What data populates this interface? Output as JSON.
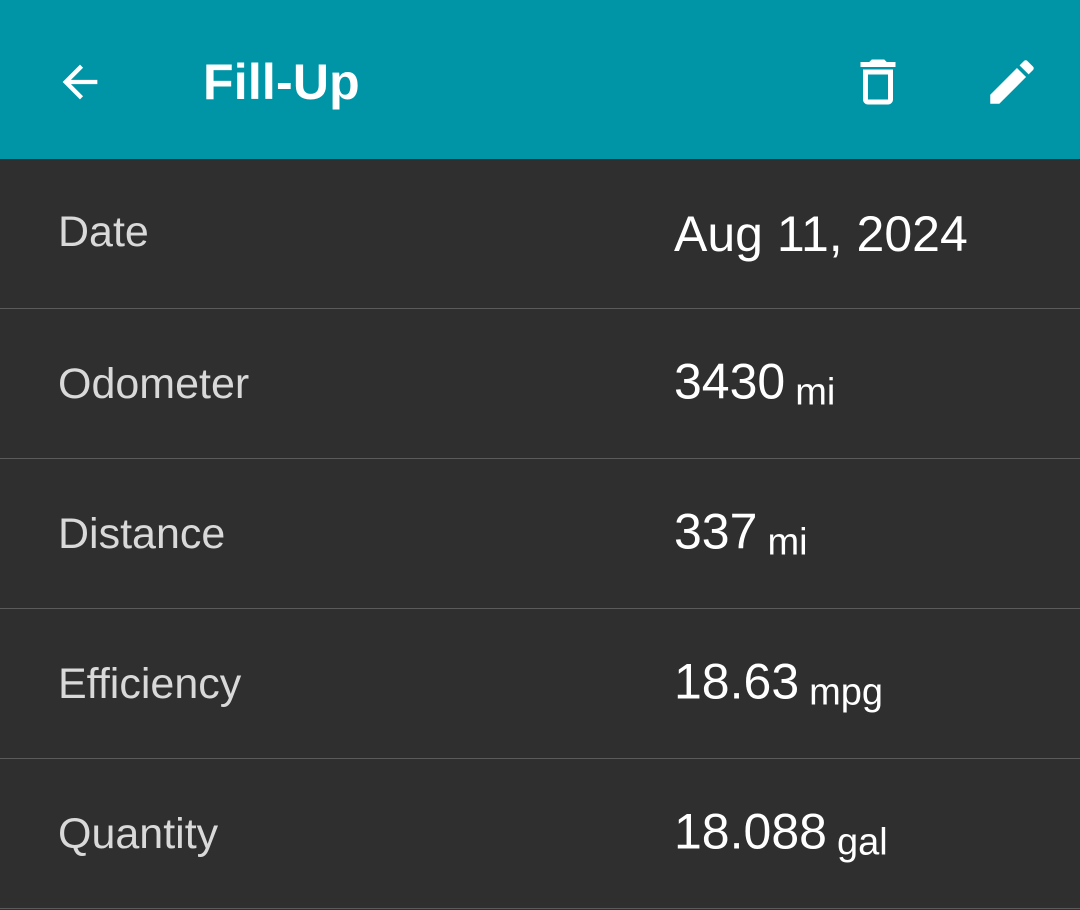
{
  "appbar": {
    "title": "Fill-Up",
    "back_icon": "arrow-back-icon",
    "delete_icon": "trash-icon",
    "edit_icon": "pencil-icon",
    "background": "#0095a6"
  },
  "details": {
    "date": {
      "label": "Date",
      "value": "Aug 11, 2024"
    },
    "odometer": {
      "label": "Odometer",
      "value": "3430",
      "unit": "mi"
    },
    "distance": {
      "label": "Distance",
      "value": "337",
      "unit": "mi"
    },
    "efficiency": {
      "label": "Efficiency",
      "value": "18.63",
      "unit": "mpg"
    },
    "quantity": {
      "label": "Quantity",
      "value": "18.088",
      "unit": "gal"
    }
  }
}
